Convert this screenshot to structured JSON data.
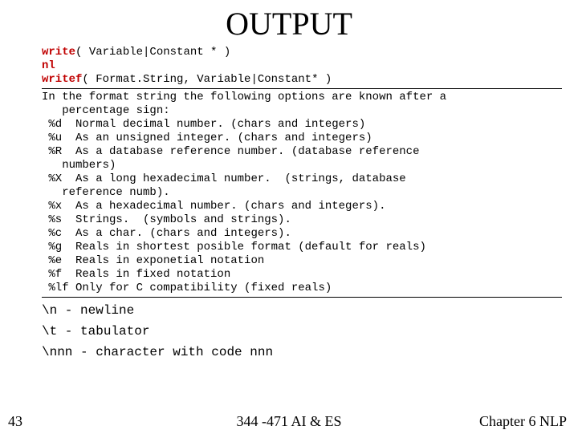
{
  "title": "OUTPUT",
  "sig": {
    "write_fn": "write",
    "write_args": "( Variable|Constant * )",
    "nl": "nl",
    "writef_fn": "writef",
    "writef_args": "( Format.String, Variable|Constant* )"
  },
  "desc": {
    "intro1": "In the format string the following options are known after a",
    "intro2": "   percentage sign:",
    "d": " %d  Normal decimal number. (chars and integers)",
    "u": " %u  As an unsigned integer. (chars and integers)",
    "R1": " %R  As a database reference number. (database reference",
    "R2": "   numbers)",
    "X1": " %X  As a long hexadecimal number.  (strings, database",
    "X2": "   reference numb).",
    "x": " %x  As a hexadecimal number. (chars and integers).",
    "s": " %s  Strings.  (symbols and strings).",
    "c": " %c  As a char. (chars and integers).",
    "g": " %g  Reals in shortest posible format (default for reals)",
    "e": " %e  Reals in exponetial notation",
    "f": " %f  Reals in fixed notation",
    "lf": " %lf Only for C compatibility (fixed reals)"
  },
  "escapes": {
    "n": "\\n - newline",
    "t": "\\t - tabulator",
    "nnn": "\\nnn - character with code nnn"
  },
  "footer": {
    "page": "43",
    "center": "344 -471 AI & ES",
    "right": "Chapter 6 NLP"
  }
}
